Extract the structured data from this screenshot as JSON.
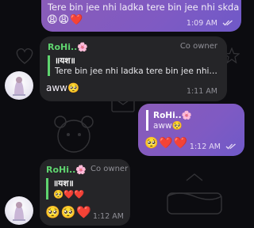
{
  "messages": [
    {
      "type": "outgoing",
      "text": "Tere bin jee nhi ladka tere bin jee nhi skda",
      "emoji": "😩😩❤️",
      "time": "1:09 AM"
    },
    {
      "type": "incoming",
      "sender": "RoHi..🌸",
      "role": "Co owner",
      "reply": {
        "name": "॥यश॥",
        "text": "Tere bin jee nhi ladka tere bin jee nhi s..."
      },
      "text": "aww🥺",
      "time": "1:11 AM"
    },
    {
      "type": "outgoing",
      "reply": {
        "name": "RoHi..🌸",
        "text": "aww🥺"
      },
      "emoji": "🥺❤️❤️",
      "time": "1:12 AM"
    },
    {
      "type": "incoming",
      "sender": "RoHi..🌸",
      "role": "Co owner",
      "reply": {
        "name": "॥यश॥",
        "text": "🥺❤️❤️"
      },
      "emoji": "🥺🥺❤️",
      "time": "1:12 AM"
    }
  ],
  "colors": {
    "background": "#0c0c10",
    "outgoing_bubble": "#8a5cb8",
    "incoming_bubble": "#252528",
    "sender_name": "#5fd46f"
  },
  "icons": [
    "double-check-icon",
    "avatar-icon"
  ]
}
